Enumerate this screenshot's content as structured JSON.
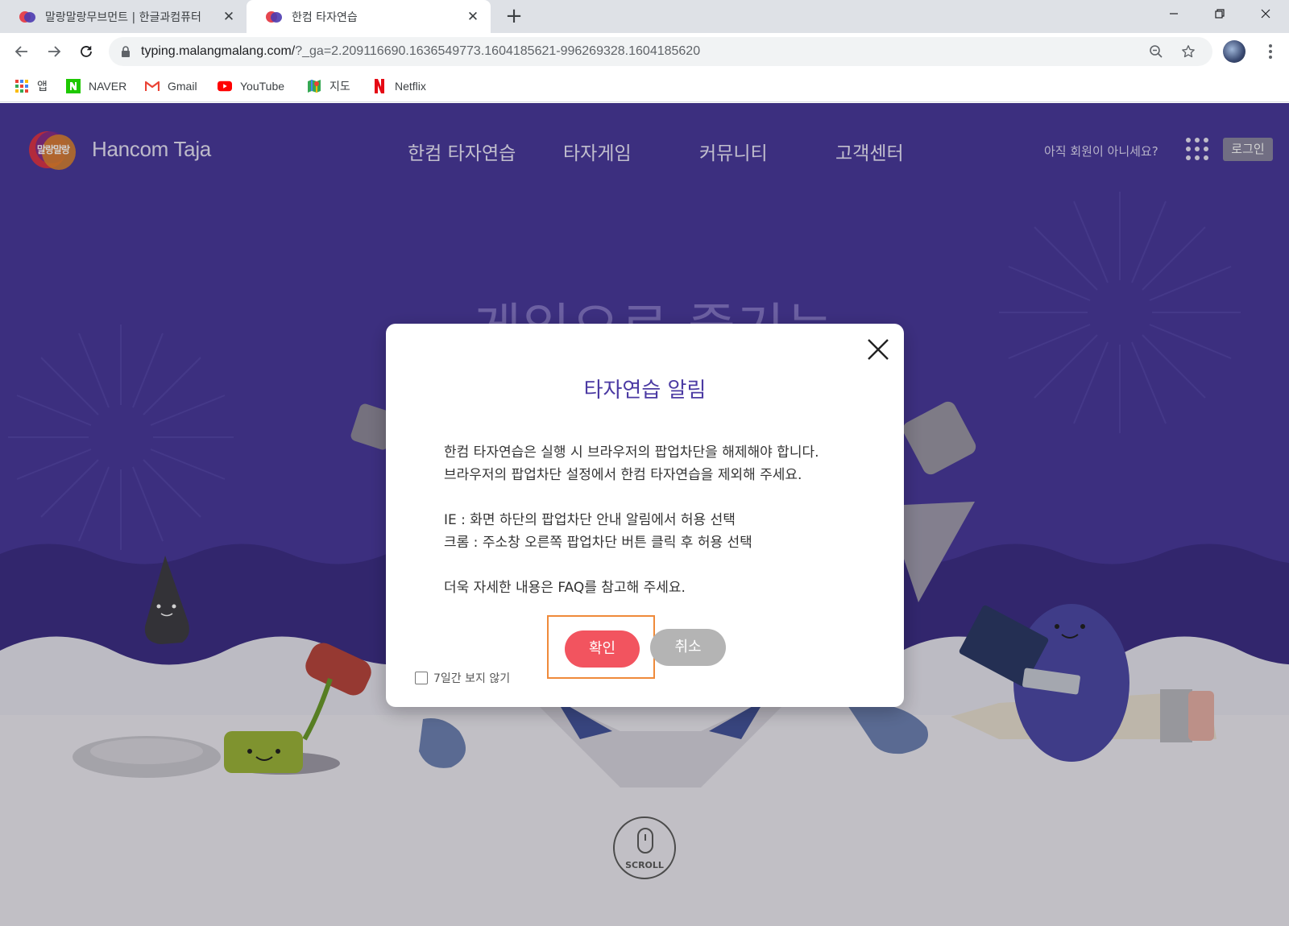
{
  "browser": {
    "tabs": [
      {
        "title": "말랑말랑무브먼트 | 한글과컴퓨터",
        "active": false
      },
      {
        "title": "한컴 타자연습",
        "active": true
      }
    ],
    "url_host": "typing.malangmalang.com/",
    "url_rest": "?_ga=2.209116690.1636549773.1604185621-996269328.1604185620",
    "bookmarks": [
      {
        "label": "앱",
        "icon": "apps-grid-icon"
      },
      {
        "label": "NAVER",
        "icon": "naver-icon"
      },
      {
        "label": "Gmail",
        "icon": "gmail-icon"
      },
      {
        "label": "YouTube",
        "icon": "youtube-icon"
      },
      {
        "label": "지도",
        "icon": "maps-icon"
      },
      {
        "label": "Netflix",
        "icon": "netflix-icon"
      }
    ]
  },
  "site": {
    "logo_text": "말랑말랑",
    "brand": "Hancom Taja",
    "nav": [
      "한컴 타자연습",
      "타자게임",
      "커뮤니티",
      "고객센터"
    ],
    "join_prompt": "아직 회원이 아니세요?",
    "login_label": "로그인",
    "hero_text": "게임으로 즐기는",
    "scroll_label": "SCROLL",
    "colors": {
      "header_bg": "#4a3a9c",
      "wave": "#3d2f86"
    }
  },
  "modal": {
    "title": "타자연습 알림",
    "lines": [
      "한컴 타자연습은 실행 시 브라우저의 팝업차단을 해제해야 합니다.",
      "브라우저의 팝업차단 설정에서 한컴 타자연습을 제외해 주세요.",
      "IE : 화면 하단의 팝업차단 안내 알림에서 허용 선택",
      "크롬 : 주소창 오른쪽 팝업차단 버튼 클릭 후 허용 선택",
      "더욱 자세한 내용은 FAQ를 참고해 주세요."
    ],
    "confirm_label": "확인",
    "cancel_label": "취소",
    "hide_7days_label": "7일간 보지 않기",
    "hide_7days_checked": false,
    "colors": {
      "title": "#4b3aa3",
      "confirm": "#f2545f",
      "cancel": "#b4b4b4",
      "highlight": "#ef8a3a"
    }
  }
}
